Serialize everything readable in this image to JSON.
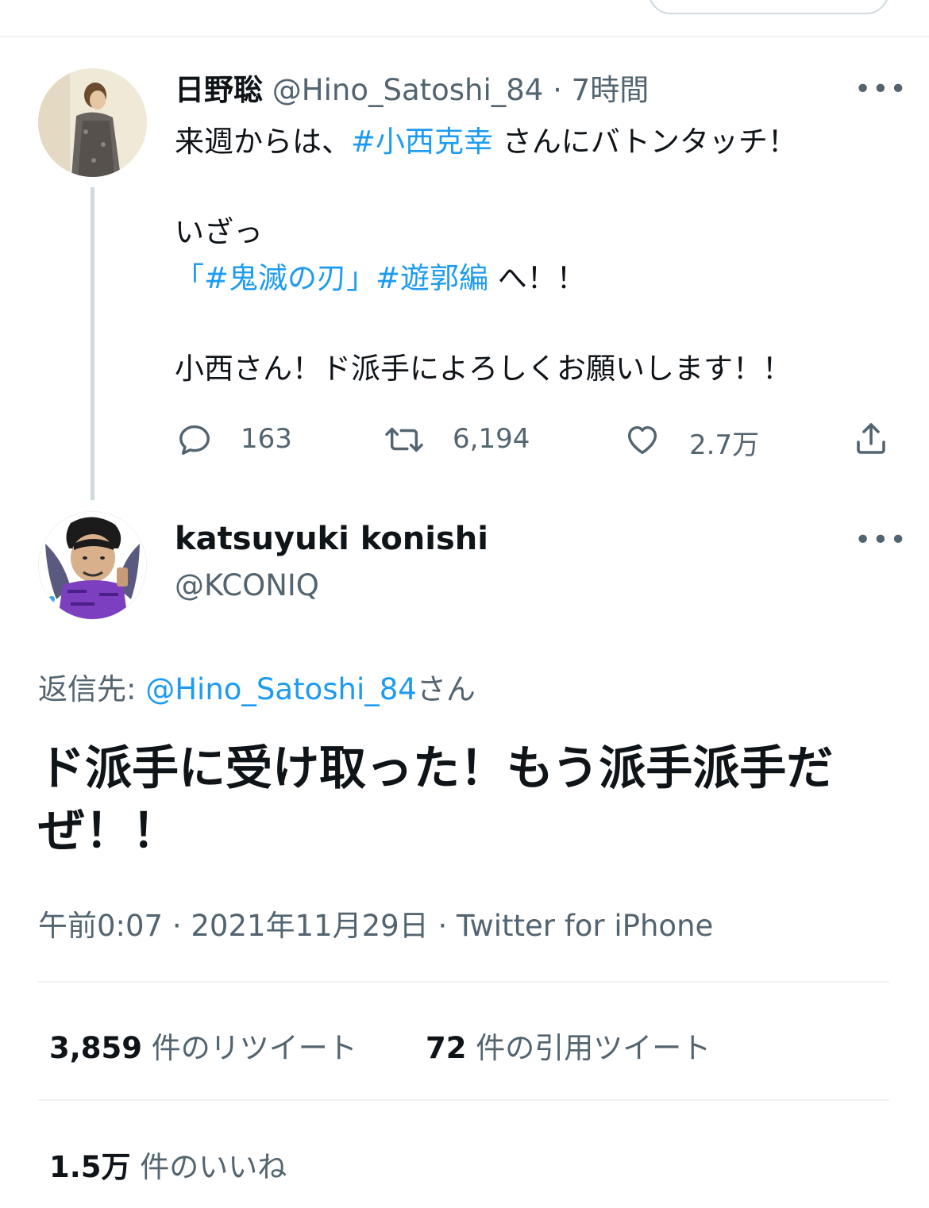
{
  "colors": {
    "link": "#1d9bf0",
    "muted": "#536471",
    "text": "#0f1419",
    "divider": "#eff3f4"
  },
  "tweet_parent": {
    "display_name": "日野聡",
    "handle": "@Hino_Satoshi_84",
    "separator": "·",
    "time": "7時間",
    "more_label": "•••",
    "lines": {
      "l1_pre": "来週からは、",
      "l1_tag": "#小西克幸",
      "l1_post": " さんにバトンタッチ！",
      "l2": "いざっ",
      "l3_open": "「",
      "l3_tag1": "#鬼滅の刃",
      "l3_mid": "」",
      "l3_tag2": "#遊郭編",
      "l3_post": " へ！！",
      "l4": "小西さん！ド派手によろしくお願いします！！"
    },
    "actions": {
      "reply_icon": "reply-icon",
      "reply_count": "163",
      "retweet_icon": "retweet-icon",
      "retweet_count": "6,194",
      "like_icon": "heart-icon",
      "like_count": "2.7万",
      "share_icon": "share-icon"
    }
  },
  "tweet_main": {
    "display_name": "katsuyuki konishi",
    "handle": "@KCONIQ",
    "more_label": "•••",
    "reply_to_label": "返信先: ",
    "reply_to_handle": "@Hino_Satoshi_84",
    "reply_to_suffix": "さん",
    "text": "ド派手に受け取った！もう派手派手だぜ！！",
    "meta": "午前0:07 · 2021年11月29日 · Twitter for iPhone"
  },
  "stats": {
    "retweets_count": "3,859",
    "retweets_label": " 件のリツイート",
    "quotes_count": "72",
    "quotes_label": " 件の引用ツイート",
    "likes_count": "1.5万",
    "likes_label": " 件のいいね"
  }
}
